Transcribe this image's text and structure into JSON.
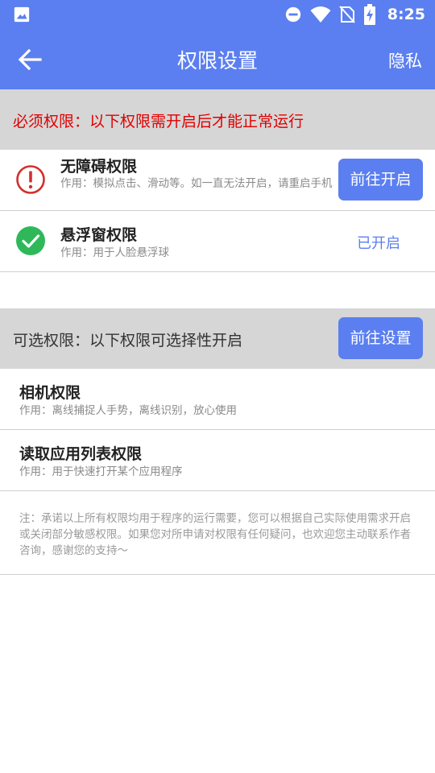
{
  "status_bar": {
    "time": "8:25",
    "icons": [
      "image-icon",
      "do-not-disturb-icon",
      "wifi-icon",
      "no-sim-icon",
      "battery-charging-icon"
    ]
  },
  "app_bar": {
    "back_icon": "arrow-left-icon",
    "title": "权限设置",
    "privacy_label": "隐私"
  },
  "required": {
    "header": "必须权限：以下权限需开启后才能正常运行",
    "items": [
      {
        "name": "无障碍权限",
        "desc": "作用：模拟点击、滑动等。如一直无法开启，请重启手机",
        "status_icon": "warning-circle-icon",
        "action_label": "前往开启"
      },
      {
        "name": "悬浮窗权限",
        "desc": "作用：用于人脸悬浮球",
        "status_icon": "check-circle-icon",
        "state_label": "已开启"
      }
    ]
  },
  "optional": {
    "header": "可选权限：以下权限可选择性开启",
    "action_label": "前往设置",
    "items": [
      {
        "name": "相机权限",
        "desc": "作用：离线捕捉人手势，离线识别，放心使用"
      },
      {
        "name": "读取应用列表权限",
        "desc": "作用：用于快速打开某个应用程序"
      }
    ]
  },
  "note": "注：承诺以上所有权限均用于程序的运行需要，您可以根据自己实际使用需求开启或关闭部分敏感权限。如果您对所申请对权限有任何疑问，也欢迎您主动联系作者咨询，感谢您的支持～",
  "colors": {
    "primary": "#5b7ff0",
    "required_text": "#e00000",
    "warning": "#d32f2f",
    "success": "#2fb85a"
  }
}
